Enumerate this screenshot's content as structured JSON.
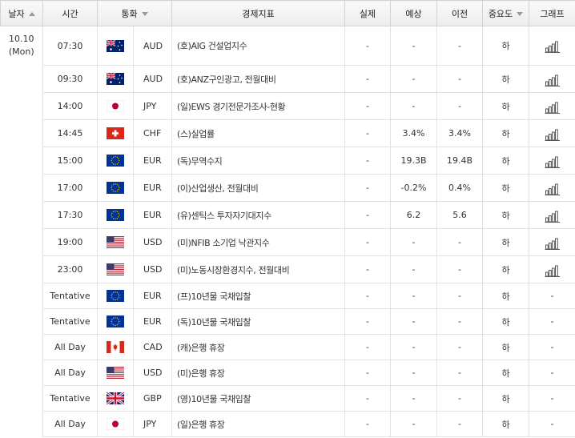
{
  "headers": {
    "date": "날자",
    "time": "시간",
    "currency": "통화",
    "indicator": "경제지표",
    "actual": "실제",
    "forecast": "예상",
    "previous": "이전",
    "importance": "중요도",
    "graph": "그래프"
  },
  "date": {
    "day": "10.10",
    "weekday": "(Mon)"
  },
  "rows": [
    {
      "time": "07:30",
      "flag": "au",
      "currency": "AUD",
      "indicator": "(호)AIG 건설업지수",
      "actual": "-",
      "forecast": "-",
      "previous": "-",
      "importance": "하",
      "graph": true
    },
    {
      "time": "09:30",
      "flag": "au",
      "currency": "AUD",
      "indicator": "(호)ANZ구인광고, 전월대비",
      "actual": "-",
      "forecast": "-",
      "previous": "-",
      "importance": "하",
      "graph": true
    },
    {
      "time": "14:00",
      "flag": "jp",
      "currency": "JPY",
      "indicator": "(일)EWS 경기전문가조사-현황",
      "actual": "-",
      "forecast": "-",
      "previous": "-",
      "importance": "하",
      "graph": true
    },
    {
      "time": "14:45",
      "flag": "ch",
      "currency": "CHF",
      "indicator": "(스)실업률",
      "actual": "-",
      "forecast": "3.4%",
      "previous": "3.4%",
      "importance": "하",
      "graph": true
    },
    {
      "time": "15:00",
      "flag": "eu",
      "currency": "EUR",
      "indicator": "(독)무역수지",
      "actual": "-",
      "forecast": "19.3B",
      "previous": "19.4B",
      "importance": "하",
      "graph": true
    },
    {
      "time": "17:00",
      "flag": "eu",
      "currency": "EUR",
      "indicator": "(이)산업생산, 전월대비",
      "actual": "-",
      "forecast": "-0.2%",
      "previous": "0.4%",
      "importance": "하",
      "graph": true
    },
    {
      "time": "17:30",
      "flag": "eu",
      "currency": "EUR",
      "indicator": "(유)센틱스 투자자기대지수",
      "actual": "-",
      "forecast": "6.2",
      "previous": "5.6",
      "importance": "하",
      "graph": true
    },
    {
      "time": "19:00",
      "flag": "us",
      "currency": "USD",
      "indicator": "(미)NFIB 소기업 낙관지수",
      "actual": "-",
      "forecast": "-",
      "previous": "-",
      "importance": "하",
      "graph": true
    },
    {
      "time": "23:00",
      "flag": "us",
      "currency": "USD",
      "indicator": "(미)노동시장환경지수, 전월대비",
      "actual": "-",
      "forecast": "-",
      "previous": "-",
      "importance": "하",
      "graph": true
    },
    {
      "time": "Tentative",
      "flag": "eu",
      "currency": "EUR",
      "indicator": "(프)10년물 국채입찰",
      "actual": "-",
      "forecast": "-",
      "previous": "-",
      "importance": "하",
      "graph": false,
      "graph_text": "-"
    },
    {
      "time": "Tentative",
      "flag": "eu",
      "currency": "EUR",
      "indicator": "(독)10년물 국채입찰",
      "actual": "-",
      "forecast": "-",
      "previous": "-",
      "importance": "하",
      "graph": false,
      "graph_text": "-"
    },
    {
      "time": "All Day",
      "flag": "ca",
      "currency": "CAD",
      "indicator": "(캐)은행 휴장",
      "actual": "-",
      "forecast": "-",
      "previous": "-",
      "importance": "하",
      "graph": false,
      "graph_text": "-"
    },
    {
      "time": "All Day",
      "flag": "us",
      "currency": "USD",
      "indicator": "(미)은행 휴장",
      "actual": "-",
      "forecast": "-",
      "previous": "-",
      "importance": "하",
      "graph": false,
      "graph_text": "-"
    },
    {
      "time": "Tentative",
      "flag": "gb",
      "currency": "GBP",
      "indicator": "(영)10년물 국채입찰",
      "actual": "-",
      "forecast": "-",
      "previous": "-",
      "importance": "하",
      "graph": false,
      "graph_text": "-"
    },
    {
      "time": "All Day",
      "flag": "jp",
      "currency": "JPY",
      "indicator": "(일)은행 휴장",
      "actual": "-",
      "forecast": "-",
      "previous": "-",
      "importance": "하",
      "graph": false,
      "graph_text": "-"
    }
  ],
  "flag_icons": {
    "au": "australia-flag-icon",
    "jp": "japan-flag-icon",
    "ch": "switzerland-flag-icon",
    "eu": "eu-flag-icon",
    "us": "usa-flag-icon",
    "ca": "canada-flag-icon",
    "gb": "uk-flag-icon"
  },
  "colors": {
    "border": "#e2e2e2",
    "header_bg": "#ececec",
    "text": "#333333"
  }
}
